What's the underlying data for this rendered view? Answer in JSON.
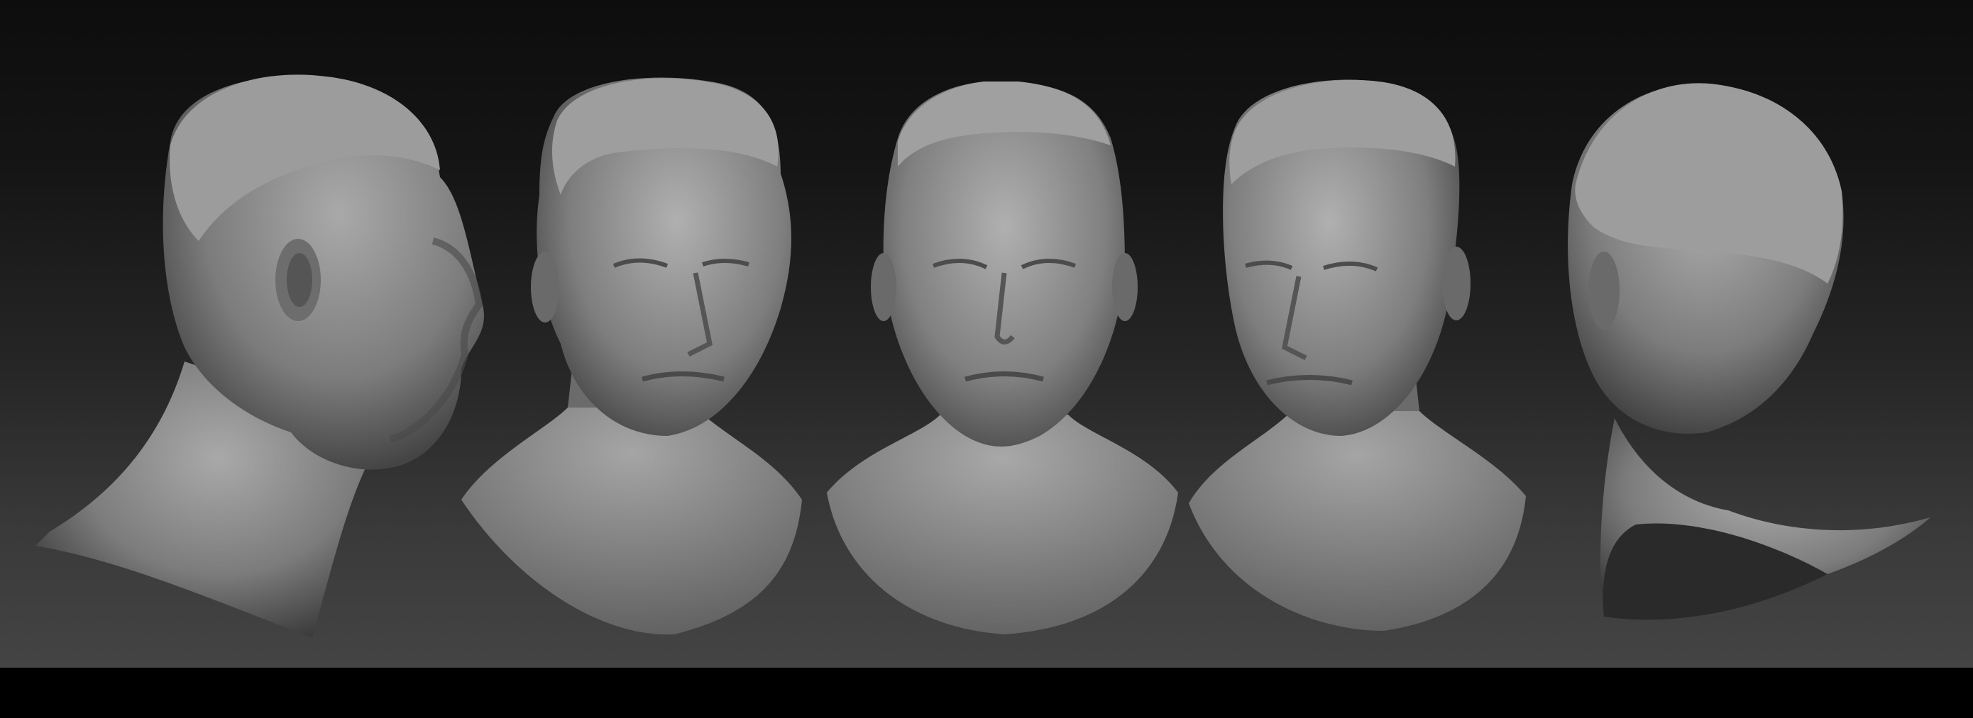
{
  "scene": {
    "description_type": "render",
    "background_top": "#0d0d0d",
    "background_bottom": "#444444",
    "letterbox_color": "#000000",
    "clay_color": "#8a8a8a"
  },
  "busts": [
    {
      "view": "left-profile"
    },
    {
      "view": "three-quarter-right"
    },
    {
      "view": "front"
    },
    {
      "view": "three-quarter-left"
    },
    {
      "view": "back-three-quarter"
    }
  ]
}
